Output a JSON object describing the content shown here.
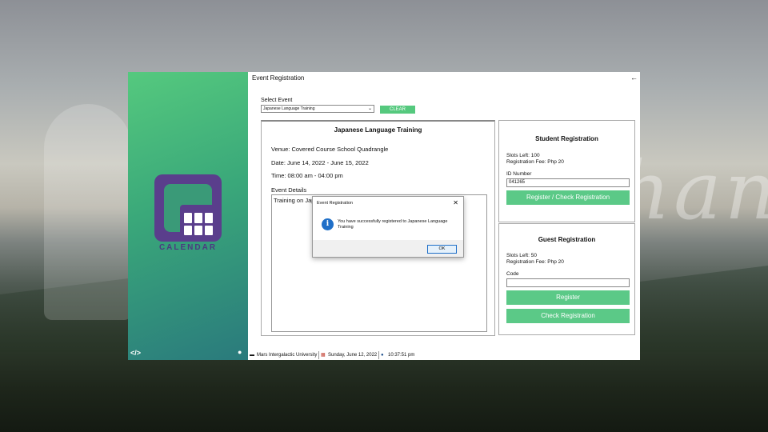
{
  "background": {
    "watermark": "helping hand"
  },
  "sidebar": {
    "logo_text": "CALENDAR",
    "code_icon": "code-icon",
    "palette_icon": "palette-icon",
    "accent_color": "#55c97e"
  },
  "header": {
    "title": "Event Registration",
    "back_glyph": "←"
  },
  "event_select": {
    "label": "Select Event",
    "value": "Japanese Language Training",
    "clear_label": "CLEAR"
  },
  "event": {
    "title": "Japanese Language Training",
    "venue": "Venue: Covered Course School Quadrangle",
    "date": "Date: June 14, 2022 - June 15, 2022",
    "time": "Time: 08:00 am - 04:00 pm",
    "details_label": "Event Details",
    "details_text": "Training on Japanese"
  },
  "student_registration": {
    "title": "Student Registration",
    "slots": "Slots Left: 100",
    "fee": "Registration Fee: Php 20",
    "id_label": "ID Number",
    "id_value": "041265",
    "button_label": "Register / Check Registration"
  },
  "guest_registration": {
    "title": "Guest Registration",
    "slots": "Slots Left: 50",
    "fee": "Registration Fee: Php 20",
    "code_label": "Code",
    "code_value": "",
    "register_label": "Register",
    "check_label": "Check Registration"
  },
  "status_bar": {
    "university": "Mars Intergalactic University",
    "date": "Sunday, June 12, 2022",
    "time": "10:37:51 pm"
  },
  "dialog": {
    "title": "Event Registration",
    "close_glyph": "✕",
    "message": "You have successfully registered to Japanese Language Training",
    "icon": "i",
    "ok_label": "OK"
  }
}
